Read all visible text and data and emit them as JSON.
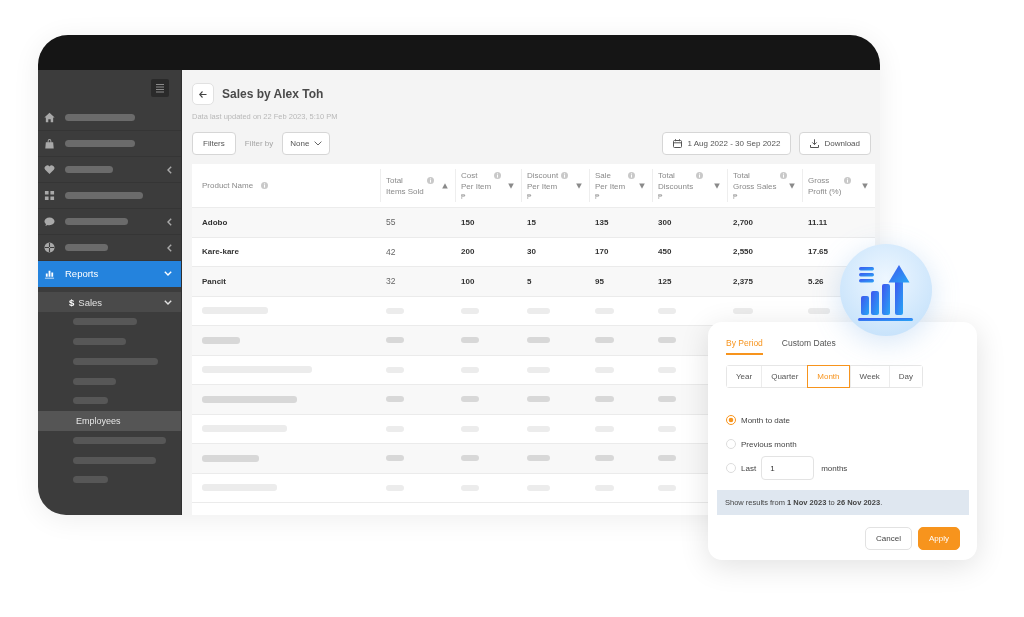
{
  "sidebar": {
    "items": [
      {
        "kind": "placeholder",
        "selected": false
      },
      {
        "kind": "placeholder",
        "selected": false
      },
      {
        "kind": "placeholder",
        "selected": false,
        "expanded": false
      },
      {
        "kind": "placeholder",
        "selected": false
      },
      {
        "kind": "placeholder",
        "selected": false,
        "expanded": false
      },
      {
        "kind": "placeholder",
        "selected": false,
        "expanded": false
      },
      {
        "kind": "link",
        "label": "Reports",
        "selected": true,
        "expanded": true,
        "children": [
          {
            "kind": "link",
            "icon_glyph": "$",
            "label": "Sales",
            "selected": false,
            "expanded": true,
            "children": [
              {
                "kind": "placeholder",
                "selected": false
              },
              {
                "kind": "placeholder",
                "selected": false
              },
              {
                "kind": "placeholder",
                "selected": false
              },
              {
                "kind": "placeholder",
                "selected": false
              },
              {
                "kind": "placeholder",
                "selected": false
              },
              {
                "kind": "link",
                "label": "Employees",
                "selected": true
              },
              {
                "kind": "placeholder",
                "selected": false
              },
              {
                "kind": "placeholder",
                "selected": false
              },
              {
                "kind": "placeholder",
                "selected": false
              }
            ]
          }
        ]
      }
    ]
  },
  "header": {
    "title": "Sales by Alex Toh",
    "last_updated": "Data last updated on 22 Feb 2023, 5:10 PM"
  },
  "toolbar": {
    "filters_button": "Filters",
    "filter_label": "Filter by",
    "filter_value": "None",
    "date_range": "1 Aug 2022 - 30 Sep 2022",
    "download_button": "Download"
  },
  "table": {
    "columns": [
      {
        "label_lines": [
          "Product Name"
        ]
      },
      {
        "label_lines": [
          "Total",
          "Items Sold"
        ],
        "sort_ascending": true
      },
      {
        "label_lines": [
          "Cost",
          "Per Item"
        ],
        "unit": "₱",
        "sort_ascending": false
      },
      {
        "label_lines": [
          "Discount",
          "Per Item"
        ],
        "unit": "₱",
        "sort_ascending": false
      },
      {
        "label_lines": [
          "Sale",
          "Per Item"
        ],
        "unit": "₱",
        "sort_ascending": false
      },
      {
        "label_lines": [
          "Total",
          "Discounts"
        ],
        "unit": "₱",
        "sort_ascending": false
      },
      {
        "label_lines": [
          "Total",
          "Gross Sales"
        ],
        "unit": "₱",
        "sort_ascending": false
      },
      {
        "label_lines": [
          "Gross",
          "Profit (%)"
        ],
        "sort_ascending": false
      }
    ],
    "rows": [
      {
        "kind": "data",
        "cells": [
          "Adobo",
          "55",
          "150",
          "15",
          "135",
          "300",
          "2,700",
          "11.11"
        ]
      },
      {
        "kind": "data",
        "cells": [
          "Kare-kare",
          "42",
          "200",
          "30",
          "170",
          "450",
          "2,550",
          "17.65"
        ]
      },
      {
        "kind": "data",
        "cells": [
          "Pancit",
          "32",
          "100",
          "5",
          "95",
          "125",
          "2,375",
          "5.26"
        ]
      },
      {
        "kind": "placeholder"
      },
      {
        "kind": "placeholder"
      },
      {
        "kind": "placeholder"
      },
      {
        "kind": "placeholder"
      },
      {
        "kind": "placeholder"
      },
      {
        "kind": "placeholder"
      },
      {
        "kind": "placeholder"
      }
    ]
  },
  "period_picker": {
    "tabs": [
      {
        "label": "By Period",
        "selected": true
      },
      {
        "label": "Custom Dates",
        "selected": false
      }
    ],
    "periods": [
      {
        "label": "Year",
        "selected": false
      },
      {
        "label": "Quarter",
        "selected": false
      },
      {
        "label": "Month",
        "selected": true
      },
      {
        "label": "Week",
        "selected": false
      },
      {
        "label": "Day",
        "selected": false
      }
    ],
    "options": [
      {
        "kind": "plain",
        "label": "Month to date",
        "selected": true
      },
      {
        "kind": "plain",
        "label": "Previous month",
        "selected": false
      },
      {
        "kind": "count",
        "label": "Last",
        "value": "1",
        "unit": "months",
        "selected": false
      }
    ],
    "summary": "Show results from **1 Nov 2023** to **26 Nov 2023**.",
    "buttons": [
      {
        "kind": "secondary",
        "label": "Cancel"
      },
      {
        "kind": "primary",
        "label": "Apply"
      }
    ]
  }
}
